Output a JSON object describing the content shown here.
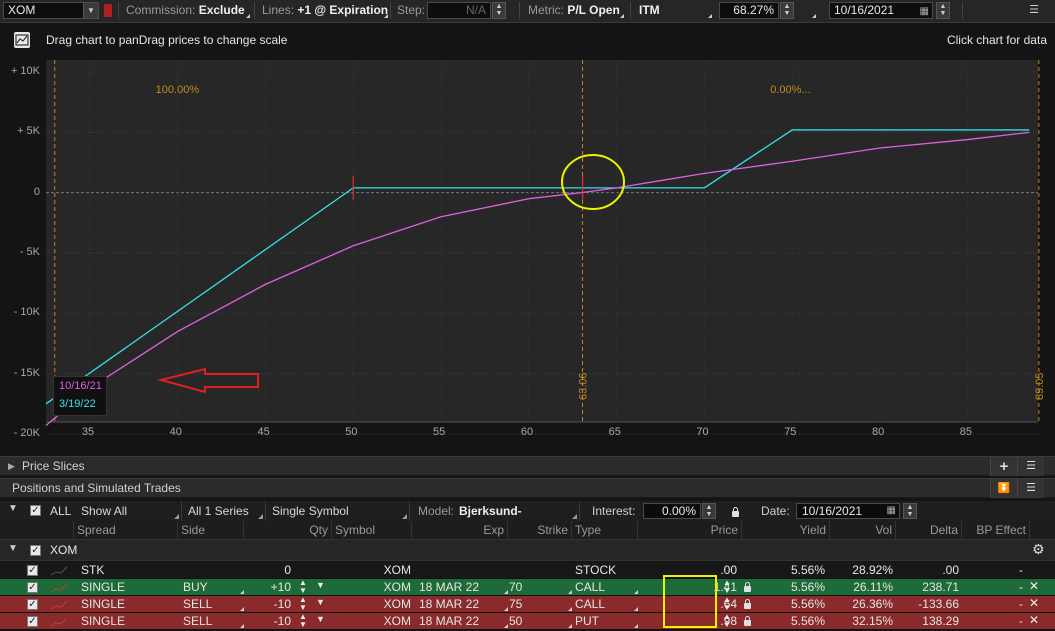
{
  "toolbar": {
    "symbol": "XOM",
    "commission_label": "Commission:",
    "commission_value": "Exclude",
    "lines_label": "Lines:",
    "lines_value": "+1 @ Expiration",
    "step_label": "Step:",
    "step_value": "N/A",
    "metric_label": "Metric:",
    "metric_value": "P/L Open",
    "itm_value": "ITM",
    "probability_value": "68.27%",
    "date_value": "10/16/2021"
  },
  "hint": {
    "text": "Drag chart to panDrag prices to change scale",
    "right_text": "Click chart for data"
  },
  "chart_data": {
    "type": "line",
    "xlim": [
      32.5,
      89
    ],
    "ylim": [
      -20000,
      10000
    ],
    "x_ticks": [
      35,
      40,
      45,
      50,
      55,
      60,
      65,
      70,
      75,
      80,
      85
    ],
    "x_tick_labels": [
      "35",
      "40",
      "45",
      "50",
      "55",
      "60",
      "65",
      "70",
      "75",
      "80",
      "85"
    ],
    "y_ticks": [
      10000,
      5000,
      0,
      -5000,
      -10000,
      -15000,
      -20000
    ],
    "y_tick_labels": [
      "+ 10K",
      "+ 5K",
      "0",
      "- 5K",
      "- 10K",
      "- 15K",
      "- 20K"
    ],
    "grid": true,
    "vlines": [
      {
        "x": 33,
        "label": "",
        "color": "#c08a1e"
      },
      {
        "x": 63.06,
        "label": "63.06",
        "color": "#c08a1e"
      },
      {
        "x": 89.05,
        "label": "89.05",
        "color": "#c08a1e"
      }
    ],
    "annotations": [
      {
        "x": 40,
        "text": "100.00%",
        "color": "#c08a1e"
      },
      {
        "x": 75,
        "text": "0.00%...",
        "color": "#c08a1e"
      }
    ],
    "series": [
      {
        "name": "3/19/22",
        "color": "#35e0e8",
        "x": [
          32.5,
          50,
          70,
          75,
          88.5
        ],
        "y": [
          -17500,
          400,
          400,
          5200,
          5200
        ]
      },
      {
        "name": "10/16/21",
        "color": "#e060e0",
        "x": [
          32.5,
          35,
          40,
          45,
          50,
          55,
          60,
          63,
          65,
          70,
          75,
          80,
          85,
          88.5
        ],
        "y": [
          -19300,
          -16200,
          -11500,
          -7600,
          -4400,
          -2000,
          -500,
          0,
          400,
          1600,
          2600,
          3700,
          4400,
          5000
        ]
      }
    ],
    "dates": [
      {
        "text": "10/16/21",
        "color": "#e060e0"
      },
      {
        "text": "3/19/22",
        "color": "#35e0e8"
      }
    ]
  },
  "price_slices": {
    "label": "Price Slices"
  },
  "positions": {
    "label": "Positions and Simulated Trades"
  },
  "filter": {
    "all_label": "ALL",
    "show_all": "Show All",
    "series": "All 1 Series",
    "symbol_mode": "Single Symbol",
    "model_label": "Model:",
    "model_value": "Bjerksund-Stensland",
    "interest_label": "Interest:",
    "interest_value": "0.00%",
    "date_label": "Date:",
    "date_value": "10/16/2021"
  },
  "columns": [
    "Spread",
    "Side",
    "Qty",
    "Symbol",
    "Exp",
    "Strike",
    "Type",
    "Price",
    "Yield",
    "Vol",
    "Delta",
    "BP Effect"
  ],
  "group": {
    "name": "XOM"
  },
  "rows": [
    {
      "spread": "STK",
      "side": "",
      "qty": "0",
      "symbol": "XOM",
      "exp": "",
      "strike": "",
      "type": "STOCK",
      "price": ".00",
      "yield": "5.56%",
      "vol": "28.92%",
      "delta": ".00",
      "bp": "-",
      "style": "neutral"
    },
    {
      "spread": "SINGLE",
      "side": "BUY",
      "qty": "+10",
      "symbol": "XOM",
      "exp": "18 MAR 22",
      "strike": "70",
      "type": "CALL",
      "price": "1.41",
      "yield": "5.56%",
      "vol": "26.11%",
      "delta": "238.71",
      "bp": "-",
      "style": "buy"
    },
    {
      "spread": "SINGLE",
      "side": "SELL",
      "qty": "-10",
      "symbol": "XOM",
      "exp": "18 MAR 22",
      "strike": "75",
      "type": "CALL",
      "price": ".64",
      "yield": "5.56%",
      "vol": "26.36%",
      "delta": "-133.66",
      "bp": "-",
      "style": "sell"
    },
    {
      "spread": "SINGLE",
      "side": "SELL",
      "qty": "-10",
      "symbol": "XOM",
      "exp": "18 MAR 22",
      "strike": "50",
      "type": "PUT",
      "price": ".98",
      "yield": "5.56%",
      "vol": "32.15%",
      "delta": "138.29",
      "bp": "-",
      "style": "sell"
    }
  ]
}
